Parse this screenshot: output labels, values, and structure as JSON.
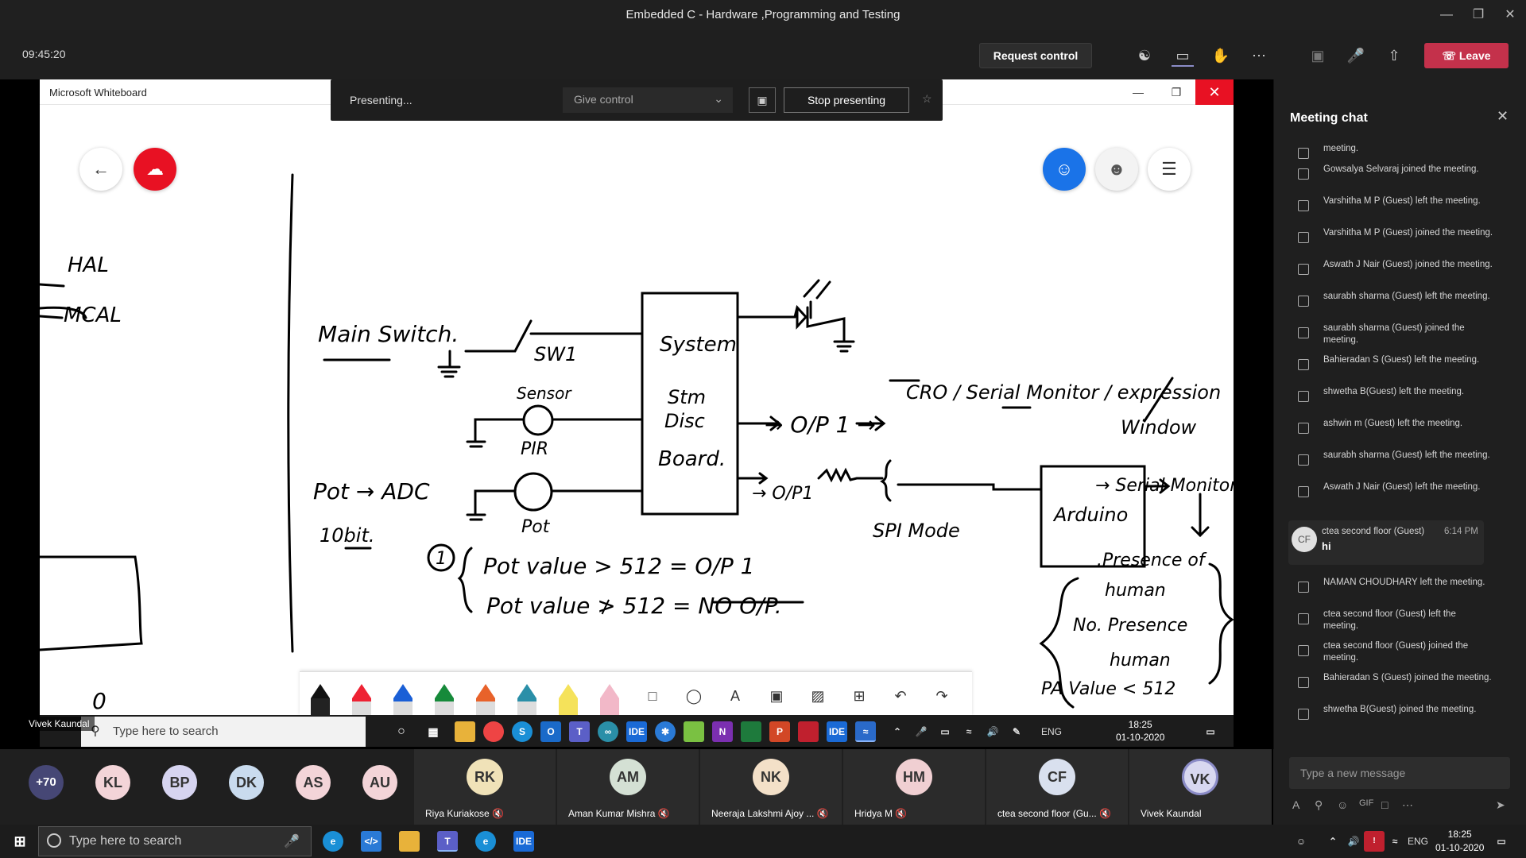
{
  "window": {
    "title": "Embedded C - Hardware ,Programming and Testing"
  },
  "teams_bar": {
    "clock": "09:45:20",
    "request_control": "Request control",
    "leave": "Leave",
    "icons": [
      "participants-icon",
      "chat-icon",
      "raise-hand-icon",
      "more-icon",
      "camera-off-icon",
      "mic-off-icon",
      "share-icon"
    ]
  },
  "presenting_bar": {
    "status": "Presenting...",
    "give_control": "Give control",
    "stop_presenting": "Stop presenting"
  },
  "whiteboard": {
    "app_title": "Microsoft Whiteboard",
    "presenter_tag": "Vivek Kaundal",
    "drawing": {
      "hal": "HAL",
      "mcal": "MCAL",
      "main_switch": "Main Switch.",
      "sw1": "SW1",
      "sensor": "Sensor",
      "pir": "PIR",
      "pot_adc": "Pot → ADC",
      "bits": "10bit.",
      "pot": "Pot",
      "system": "System",
      "stm": "Stm",
      "disc": "Disc",
      "board": "Board.",
      "op1": "→ O/P 1 →",
      "op1b": "→ O/P1",
      "cro": "CRO / Serial Monitor / expression",
      "window": "Window",
      "spi": "SPI Mode",
      "arduino": "Arduino",
      "serial_monitor": "→ Serial Monitor",
      "presence": ".Presence of",
      "human": "human",
      "no_presence": "No. Presence",
      "human2": "human",
      "pa_value": "PA Value < 512",
      "cond1": "Pot value > 512   =  O/P 1",
      "cond2": "Pot value ≯ 512   =  NO O/P.",
      "num1": "1",
      "zero": "0"
    }
  },
  "inner_taskbar": {
    "search_placeholder": "Type here to search",
    "time": "18:25",
    "date": "01-10-2020",
    "lang": "ENG",
    "ide": "IDE"
  },
  "chat": {
    "title": "Meeting chat",
    "events": [
      "meeting.",
      "Gowsalya Selvaraj joined the meeting.",
      "Varshitha M P (Guest) left the meeting.",
      "Varshitha M P (Guest) joined the meeting.",
      "Aswath J Nair (Guest) joined the meeting.",
      "saurabh sharma (Guest) left the meeting.",
      "saurabh sharma (Guest) joined the meeting.",
      "Bahieradan S (Guest) left the meeting.",
      "shwetha B(Guest) left the meeting.",
      "ashwin m (Guest) left the meeting.",
      "saurabh sharma (Guest) left the meeting.",
      "Aswath J Nair (Guest) left the meeting."
    ],
    "message": {
      "initials": "CF",
      "sender": "ctea second floor (Guest)",
      "time": "6:14 PM",
      "body": "hi"
    },
    "events_after": [
      "NAMAN CHOUDHARY left the meeting.",
      "ctea second floor (Guest) left the meeting.",
      "ctea second floor (Guest) joined the meeting.",
      "Bahieradan S (Guest) joined the meeting.",
      "shwetha B(Guest) joined the meeting."
    ],
    "compose_placeholder": "Type a new message"
  },
  "participants": {
    "overflow": "+70",
    "small": [
      {
        "initials": "KL",
        "color": "#f3d4d8"
      },
      {
        "initials": "BP",
        "color": "#d6d4f0"
      },
      {
        "initials": "DK",
        "color": "#c9dbee"
      },
      {
        "initials": "AS",
        "color": "#f3d4d8"
      },
      {
        "initials": "AU",
        "color": "#f3d4d8"
      }
    ],
    "tiles": [
      {
        "initials": "RK",
        "name": "Riya Kuriakose",
        "color": "#f0e2b8"
      },
      {
        "initials": "AM",
        "name": "Aman Kumar Mishra",
        "color": "#d4e0d4"
      },
      {
        "initials": "NK",
        "name": "Neeraja Lakshmi Ajoy ...",
        "color": "#f3e0c8"
      },
      {
        "initials": "HM",
        "name": "Hridya M",
        "color": "#f0cfd2"
      },
      {
        "initials": "CF",
        "name": "ctea second floor (Gu...",
        "color": "#d9e0ee"
      },
      {
        "initials": "VK",
        "name": "Vivek Kaundal",
        "color": "#d8d8f0"
      }
    ]
  },
  "taskbar": {
    "search_placeholder": "Type here to search",
    "time": "18:25",
    "date": "01-10-2020",
    "lang": "ENG",
    "ide": "IDE"
  }
}
